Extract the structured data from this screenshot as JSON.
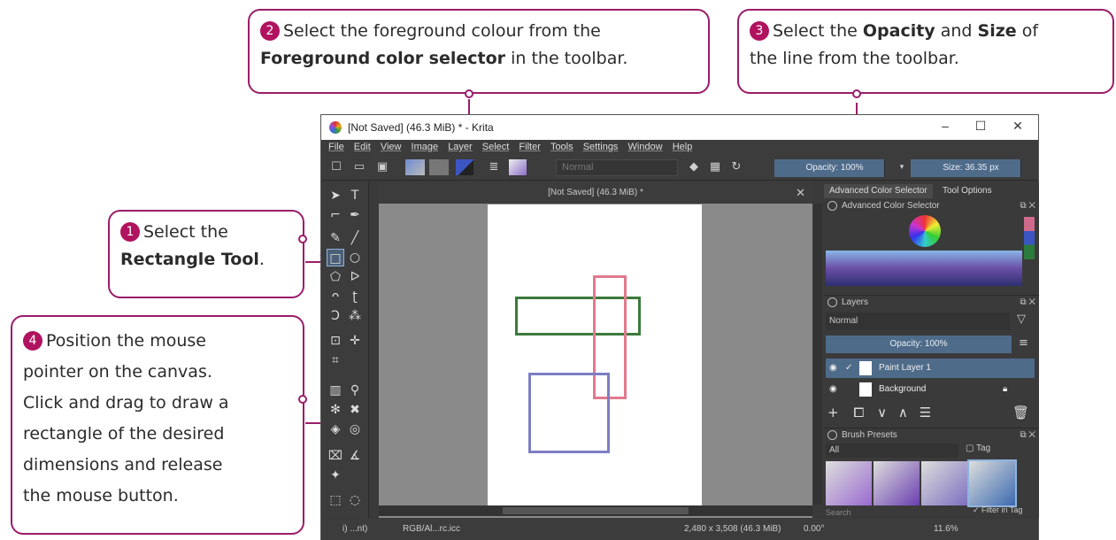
{
  "callouts": {
    "c1": {
      "num": "1",
      "line1": "Select the",
      "bold": "Rectangle Tool",
      "tail": "."
    },
    "c2": {
      "num": "2",
      "line1": "Select the foreground colour from the",
      "bold": "Foreground color selector",
      "tail": " in the toolbar."
    },
    "c3": {
      "num": "3",
      "pre": "Select the ",
      "bold1": "Opacity",
      "mid": " and ",
      "bold2": "Size",
      "post": " of",
      "line2": "the line from the toolbar."
    },
    "c4": {
      "num": "4",
      "l1": "Position the mouse",
      "l2": "pointer on the canvas.",
      "l3": "Click and drag to draw a",
      "l4": "rectangle of the desired",
      "l5": "dimensions and release",
      "l6": "the mouse button."
    }
  },
  "window": {
    "title": "[Not Saved]  (46.3 MiB) * - Krita",
    "controls": {
      "minimize": "–",
      "maximize": "☐",
      "close": "✕"
    },
    "menu": [
      "File",
      "Edit",
      "View",
      "Image",
      "Layer",
      "Select",
      "Filter",
      "Tools",
      "Settings",
      "Window",
      "Help"
    ],
    "toolbar": {
      "blend_mode": "Normal",
      "opacity": "Opacity: 100%",
      "size": "Size: 36.35 px"
    },
    "document_tab": "[Not Saved]  (46.3 MiB) *",
    "dockers": {
      "tabs": [
        "Advanced Color Selector",
        "Tool Options"
      ],
      "color_selector_title": "Advanced Color Selector",
      "layers_title": "Layers",
      "layers_blend": "Normal",
      "layers_opacity": "Opacity:  100%",
      "layers": [
        {
          "name": "Paint Layer 1",
          "selected": true
        },
        {
          "name": "Background",
          "selected": false
        }
      ],
      "brush_presets_title": "Brush Presets",
      "brush_filter": "All",
      "brush_tag": "Tag",
      "search_placeholder": "Search",
      "filter_in_tag": "Filter in Tag"
    },
    "status": {
      "tool": "i) ...nt)",
      "profile": "RGB/Al...rc.icc",
      "dimensions": "2,480 x 3,508 (46.3 MiB)",
      "rotation": "0.00°",
      "zoom": "11.6%"
    }
  },
  "colors": {
    "accent": "#9b1d6a",
    "badge": "#b0125f",
    "green_rect": "#3c7a3c",
    "pink_rect": "#e07a8c",
    "blue_rect": "#7e7ec4",
    "slider_blue": "#4f6b8a"
  }
}
